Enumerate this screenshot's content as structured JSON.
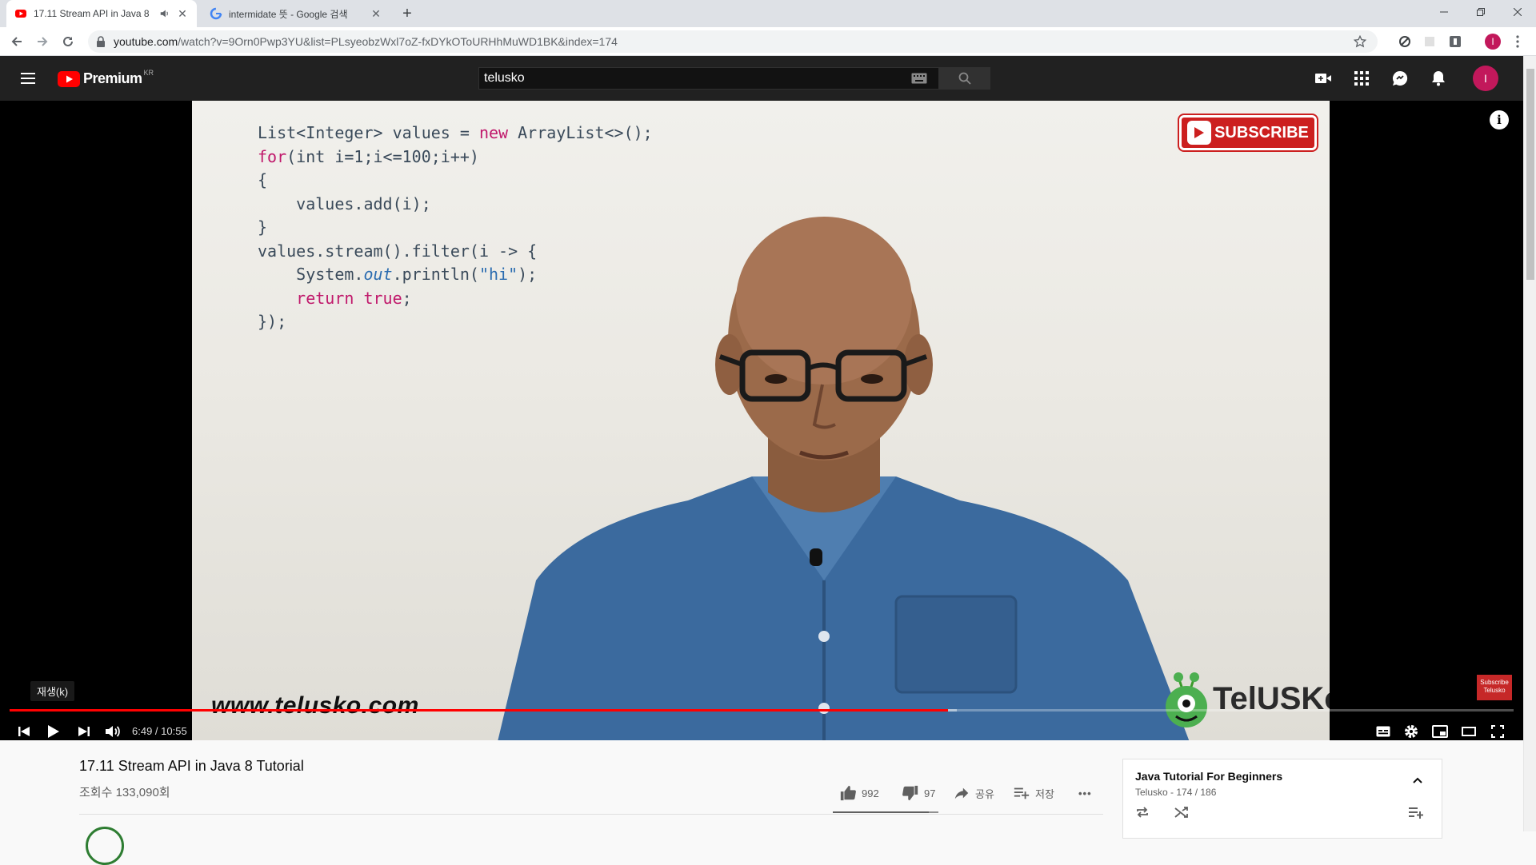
{
  "browser": {
    "tabs": [
      {
        "title": "17.11 Stream API in Java 8",
        "close": "✕"
      },
      {
        "title": "intermidate 뜻 - Google 검색",
        "close": "✕"
      }
    ],
    "new_tab": "+",
    "url": {
      "host": "youtube.com",
      "path": "/watch?v=9Orn0Pwp3YU&list=PLsyeobzWxl7oZ-fxDYkOToURHhMuWD1BK&index=174"
    },
    "profile_initial": "I"
  },
  "youtube": {
    "logo_word": "Premium",
    "region": "KR",
    "search_value": "telusko",
    "avatar_initial": "I"
  },
  "video": {
    "code_lines": [
      "List<Integer> values = new ArrayList<>();",
      "for(int i=1;i<=100;i++)",
      "{",
      "    values.add(i);",
      "}",
      "values.stream().filter(i -> {",
      "    System.out.println(\"hi\");",
      "    return true;",
      "});"
    ],
    "subscribe_badge": "SUBSCRIBE",
    "watermark_url": "www.telusko.com",
    "logo_text": "TelUSKo",
    "branding": "Subscribe Telusko",
    "tooltip": "재생(k)",
    "time_display": "6:49 / 10:55",
    "progress_played": 0.6242,
    "progress_loaded": 0.63
  },
  "details": {
    "title": "17.11 Stream API in Java 8 Tutorial",
    "views": "조회수 133,090회",
    "likes": "992",
    "dislikes": "97",
    "share": "공유",
    "save": "저장",
    "more": "•••",
    "like_ratio": 0.911
  },
  "playlist": {
    "title": "Java Tutorial For Beginners",
    "subtitle": "Telusko - 174 / 186"
  },
  "colors": {
    "youtube_red": "#ff0000",
    "masthead_bg": "#212121",
    "avatar_bg": "#c2185b",
    "code_keyword": "#c0186b"
  }
}
